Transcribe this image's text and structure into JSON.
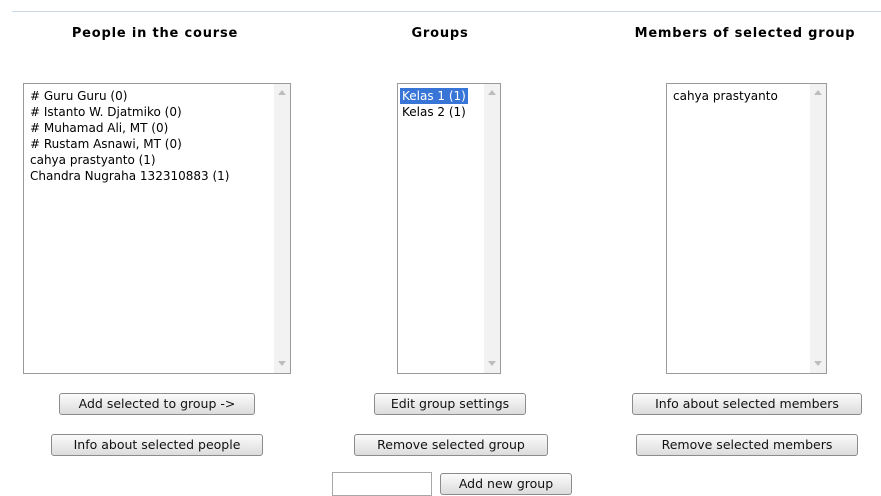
{
  "columns": {
    "people": {
      "heading": "People in the course",
      "items": [
        "# Guru Guru (0)",
        "# Istanto W. Djatmiko (0)",
        "# Muhamad Ali, MT (0)",
        "# Rustam Asnawi, MT (0)",
        "cahya prastyanto (1)",
        "Chandra Nugraha 132310883 (1)"
      ]
    },
    "groups": {
      "heading": "Groups",
      "items": [
        "Kelas 1 (1)",
        "Kelas 2 (1)"
      ],
      "selected": "Kelas 1 (1)"
    },
    "members": {
      "heading": "Members of selected group",
      "items": [
        "cahya prastyanto"
      ]
    }
  },
  "buttons": {
    "add_selected": "Add selected to group ->",
    "info_people": "Info about selected people",
    "edit_group": "Edit group settings",
    "remove_group": "Remove selected group",
    "info_members": "Info about selected members",
    "remove_members": "Remove selected members",
    "add_new_group": "Add new group"
  },
  "new_group_input": {
    "value": ""
  },
  "colors": {
    "selection": "#3875d7",
    "scrollbar": "#f2f2f2"
  }
}
